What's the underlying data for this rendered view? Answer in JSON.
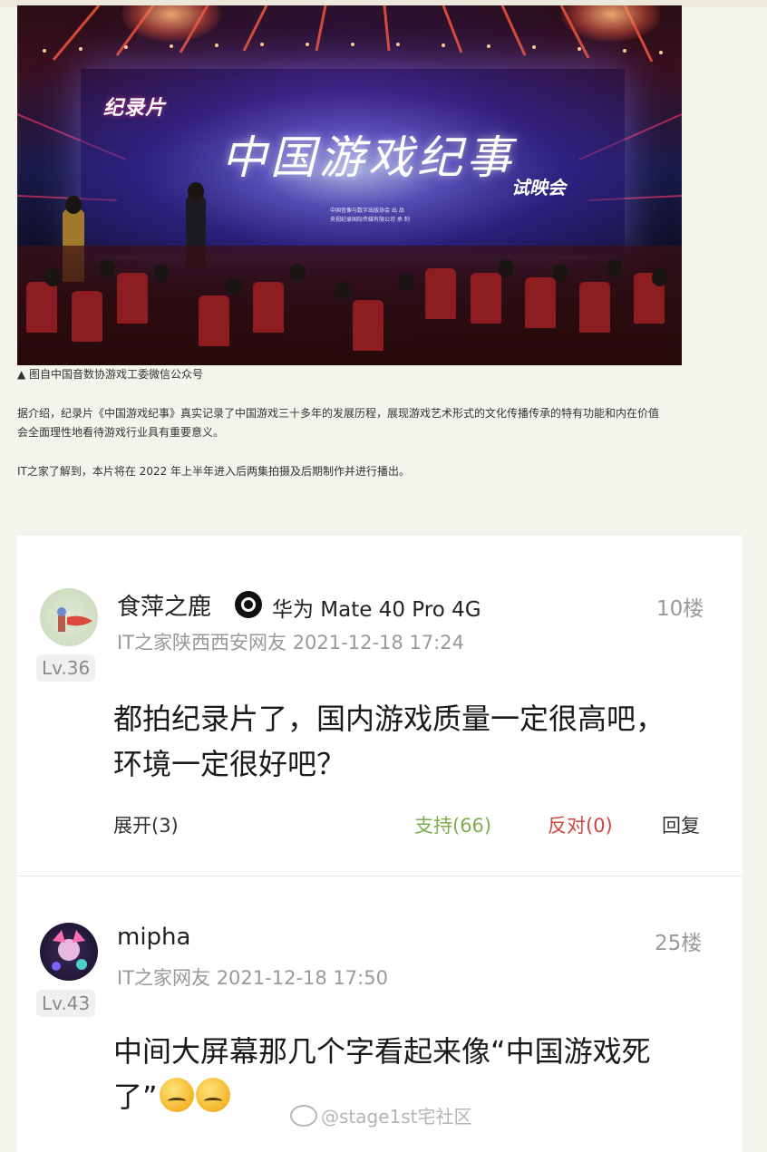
{
  "article": {
    "photo": {
      "doc_label": "纪录片",
      "title": "中国游戏纪事",
      "subtitle": "试映会",
      "credit_1": "中国音像与数字出版协会  出 品",
      "credit_2": "央视纪录国际传媒有限公司  承 制"
    },
    "caption": "▲ 图自中国音数协游戏工委微信公众号",
    "paragraph_1_line_1": "据介绍，纪录片《中国游戏纪事》真实记录了中国游戏三十多年的发展历程，展现游戏艺术形式的文化传播传承的特有功能和内在价值",
    "paragraph_1_line_2": "会全面理性地看待游戏行业具有重要意义。",
    "paragraph_2": "IT之家了解到，本片将在 2022 年上半年进入后两集拍摄及后期制作并进行播出。"
  },
  "comments": [
    {
      "username": "食萍之鹿",
      "device_icon": "device-brand-icon",
      "device": "华为 Mate 40 Pro 4G",
      "floor": "10楼",
      "level": "Lv.36",
      "location_time": "IT之家陕西西安网友 2021-12-18 17:24",
      "text_line_1": "都拍纪录片了，国内游戏质量一定很高吧，",
      "text_line_2": "环境一定很好吧？",
      "expand_label": "展开(3)",
      "support_label": "支持(66)",
      "oppose_label": "反对(0)",
      "reply_label": "回复"
    },
    {
      "username": "mipha",
      "floor": "25楼",
      "level": "Lv.43",
      "location_time": "IT之家网友 2021-12-18 17:50",
      "text_line_1": "中间大屏幕那几个字看起来像“中国游戏死",
      "text_line_2": "了”"
    }
  ],
  "colors": {
    "support": "#7cae4e",
    "oppose": "#d0453d",
    "meta": "#999999"
  },
  "watermark": "@stage1st宅社区"
}
